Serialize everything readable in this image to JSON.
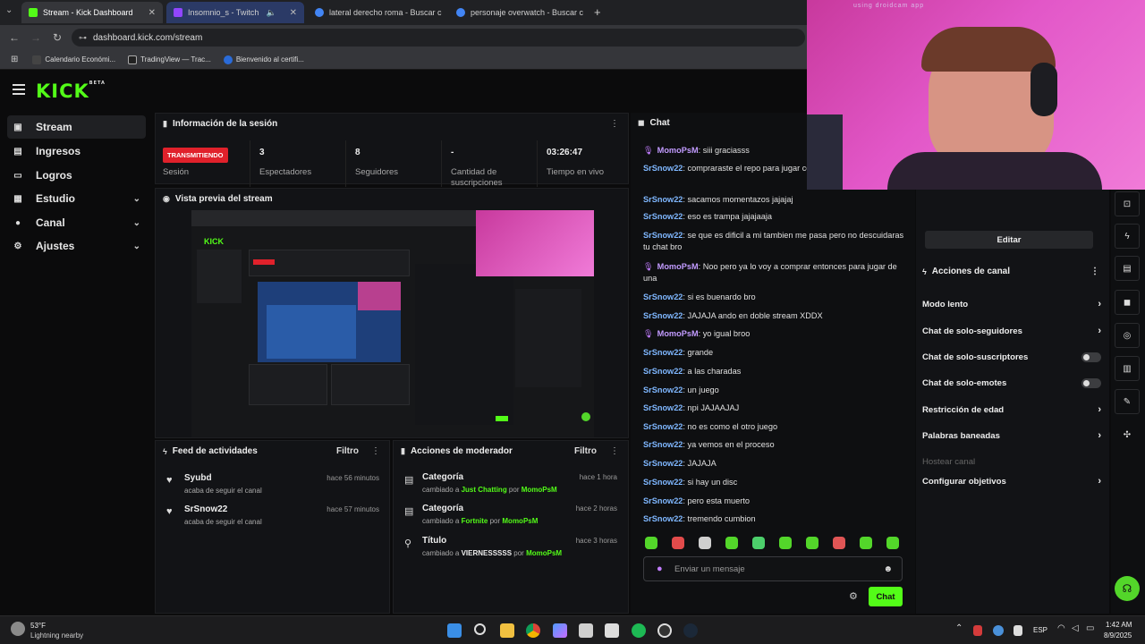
{
  "browser": {
    "tabs": [
      {
        "title": "Stream - Kick Dashboard",
        "color": "#53fc18"
      },
      {
        "title": "Insomnio_s - Twitch",
        "color": "#9146ff"
      },
      {
        "title": "lateral derecho roma - Buscar c",
        "color": "#4285f4"
      },
      {
        "title": "personaje overwatch - Buscar c",
        "color": "#4285f4"
      }
    ],
    "new_tab": "+",
    "url": "dashboard.kick.com/stream",
    "bookmarks": [
      "Calendario Económi...",
      "TradingView — Trac...",
      "Bienvenido al certifi..."
    ]
  },
  "kick": {
    "logo": "KICK",
    "logo_sup": "BETA",
    "accent": "#53fc18"
  },
  "sidebar": {
    "items": [
      {
        "label": "Stream",
        "icon": "stream-icon"
      },
      {
        "label": "Ingresos",
        "icon": "revenue-icon"
      },
      {
        "label": "Logros",
        "icon": "trophy-icon"
      },
      {
        "label": "Estudio",
        "icon": "studio-icon"
      },
      {
        "label": "Canal",
        "icon": "channel-icon"
      },
      {
        "label": "Ajustes",
        "icon": "gear-icon"
      }
    ]
  },
  "session": {
    "title": "Información de la sesión",
    "badge": "TRANSMITIENDO",
    "badge_label": "Sesión",
    "stats": [
      {
        "value": "3",
        "label": "Espectadores"
      },
      {
        "value": "8",
        "label": "Seguidores"
      },
      {
        "value": "-",
        "label": "Cantidad de suscripciones"
      },
      {
        "value": "03:26:47",
        "label": "Tiempo en vivo"
      }
    ]
  },
  "preview": {
    "title": "Vista previa del stream"
  },
  "activity": {
    "title": "Feed de actividades",
    "filter": "Filtro",
    "rows": [
      {
        "name": "Syubd",
        "sub": "acaba de seguir el canal",
        "time": "hace 56 minutos"
      },
      {
        "name": "SrSnow22",
        "sub": "acaba de seguir el canal",
        "time": "hace 57 minutos"
      }
    ]
  },
  "moderator": {
    "title": "Acciones de moderador",
    "filter": "Filtro",
    "rows": [
      {
        "name": "Categoría",
        "pre": "cambiado a ",
        "target": "Just Chatting",
        "by": " por ",
        "user": "MomoPsM",
        "time": "hace 1 hora"
      },
      {
        "name": "Categoría",
        "pre": "cambiado a ",
        "target": "Fortnite",
        "by": " por ",
        "user": "MomoPsM",
        "time": "hace 2 horas"
      },
      {
        "name": "Título",
        "pre": "cambiado a ",
        "target": "VIERNESSSSS",
        "by": " por ",
        "user": "MomoPsM",
        "time": "hace 3 horas"
      }
    ]
  },
  "chat": {
    "title": "Chat",
    "messages": [
      {
        "user": "MomoPsM",
        "text": ": siii graciasss",
        "mod": true
      },
      {
        "user": "SrSnow22",
        "text": ": compraraste el repo para jugar con stream",
        "mod": false
      },
      {
        "user": "SrSnow22",
        "text": ": sacamos momentazos jajajaj",
        "mod": false
      },
      {
        "user": "SrSnow22",
        "text": ": eso es trampa jajajaaja",
        "mod": false
      },
      {
        "user": "SrSnow22",
        "text": ": se que es dificil a mi tambien me pasa pero no descuidaras tu chat bro",
        "mod": false
      },
      {
        "user": "MomoPsM",
        "text": ": Noo pero ya lo voy a comprar entonces para jugar de una",
        "mod": true
      },
      {
        "user": "SrSnow22",
        "text": ": si es buenardo bro",
        "mod": false
      },
      {
        "user": "SrSnow22",
        "text": ": JAJAJA ando en doble stream XDDX",
        "mod": false
      },
      {
        "user": "MomoPsM",
        "text": ": yo igual broo",
        "mod": true
      },
      {
        "user": "SrSnow22",
        "text": ": grande",
        "mod": false
      },
      {
        "user": "SrSnow22",
        "text": ": a las charadas",
        "mod": false
      },
      {
        "user": "SrSnow22",
        "text": ": un juego",
        "mod": false
      },
      {
        "user": "SrSnow22",
        "text": ": npi JAJAAJAJ",
        "mod": false
      },
      {
        "user": "SrSnow22",
        "text": ": no es como el otro juego",
        "mod": false
      },
      {
        "user": "SrSnow22",
        "text": ": ya vemos en el proceso",
        "mod": false
      },
      {
        "user": "SrSnow22",
        "text": ": JAJAJA",
        "mod": false
      },
      {
        "user": "SrSnow22",
        "text": ": si hay un disc",
        "mod": false
      },
      {
        "user": "SrSnow22",
        "text": ": pero esta muerto",
        "mod": false
      },
      {
        "user": "SrSnow22",
        "text": ": tremendo cumbion",
        "mod": false
      }
    ],
    "input_placeholder": "Enviar un mensaje",
    "send": "Chat"
  },
  "channel_actions": {
    "edit": "Editar",
    "title": "Acciones de canal",
    "items": [
      {
        "label": "Modo lento",
        "kind": "arrow"
      },
      {
        "label": "Chat de solo-seguidores",
        "kind": "arrow"
      },
      {
        "label": "Chat de solo-suscriptores",
        "kind": "toggle"
      },
      {
        "label": "Chat de solo-emotes",
        "kind": "toggle"
      },
      {
        "label": "Restricción de edad",
        "kind": "arrow"
      },
      {
        "label": "Palabras baneadas",
        "kind": "arrow"
      },
      {
        "label": "Hostear canal",
        "kind": "disabled"
      },
      {
        "label": "Configurar objetivos",
        "kind": "arrow"
      }
    ]
  },
  "webcam": {
    "label": "using droidcam app"
  },
  "taskbar": {
    "weather_temp": "53°F",
    "weather_desc": "Lightning nearby",
    "lang": "ESP",
    "time": "1:42 AM",
    "date": "8/9/2025"
  }
}
